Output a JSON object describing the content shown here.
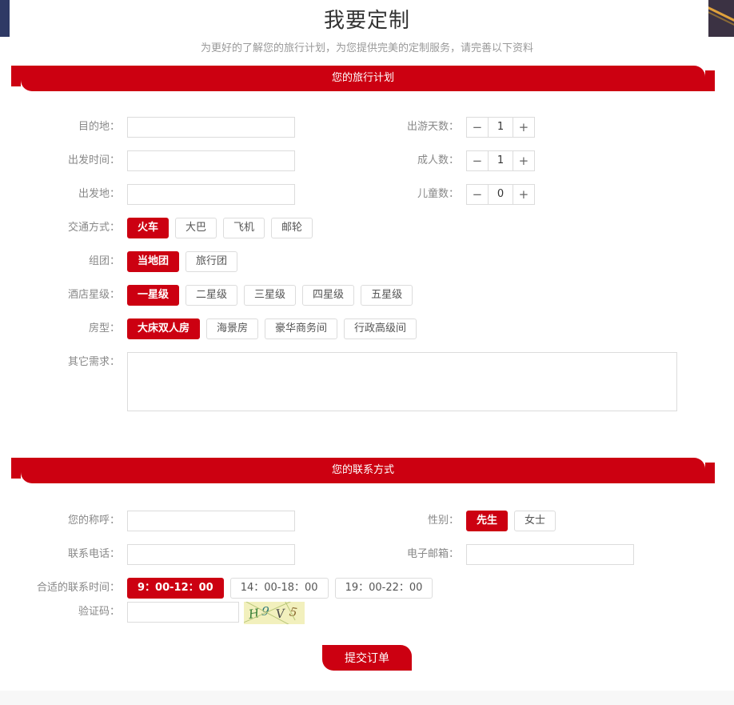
{
  "page": {
    "title": "我要定制",
    "subtitle": "为更好的了解您的旅行计划，为您提供完美的定制服务，请完善以下资料",
    "accent_color": "#cc0011",
    "label_color": "#888888",
    "border_color": "#dcdcdc"
  },
  "plan_section": {
    "banner": "您的旅行计划",
    "destination": {
      "label": "目的地：",
      "value": "",
      "placeholder": ""
    },
    "depart_time": {
      "label": "出发时间：",
      "value": "",
      "placeholder": ""
    },
    "depart_place": {
      "label": "出发地：",
      "value": "",
      "placeholder": ""
    },
    "days": {
      "label": "出游天数：",
      "value": "1",
      "minus": "−",
      "plus": "+"
    },
    "adults": {
      "label": "成人数：",
      "value": "1",
      "minus": "−",
      "plus": "+"
    },
    "children": {
      "label": "儿童数：",
      "value": "0",
      "minus": "−",
      "plus": "+"
    },
    "transport": {
      "label": "交通方式：",
      "options": [
        "火车",
        "大巴",
        "飞机",
        "邮轮"
      ],
      "selected": "火车"
    },
    "group": {
      "label": "组团：",
      "options": [
        "当地团",
        "旅行团"
      ],
      "selected": "当地团"
    },
    "hotel_star": {
      "label": "酒店星级：",
      "options": [
        "一星级",
        "二星级",
        "三星级",
        "四星级",
        "五星级"
      ],
      "selected": "一星级"
    },
    "room_type": {
      "label": "房型：",
      "options": [
        "大床双人房",
        "海景房",
        "豪华商务间",
        "行政高级间"
      ],
      "selected": "大床双人房"
    },
    "other_needs": {
      "label": "其它需求：",
      "value": "",
      "placeholder": ""
    }
  },
  "contact_section": {
    "banner": "您的联系方式",
    "name": {
      "label": "您的称呼：",
      "value": "",
      "placeholder": ""
    },
    "phone": {
      "label": "联系电话：",
      "value": "",
      "placeholder": ""
    },
    "gender": {
      "label": "性别：",
      "options": [
        "先生",
        "女士"
      ],
      "selected": "先生"
    },
    "email": {
      "label": "电子邮箱：",
      "value": "",
      "placeholder": ""
    },
    "contact_time": {
      "label": "合适的联系时间：",
      "options": [
        "9：00-12：00",
        "14：00-18：00",
        "19：00-22：00"
      ],
      "selected": "9：00-12：00"
    },
    "captcha": {
      "label": "验证码：",
      "value": "",
      "placeholder": "",
      "image_text": "H9V5",
      "image_chars": [
        "H",
        "9",
        "V",
        "5"
      ],
      "bg_color": "#f2f0bd"
    }
  },
  "submit": {
    "label": "提交订单"
  }
}
